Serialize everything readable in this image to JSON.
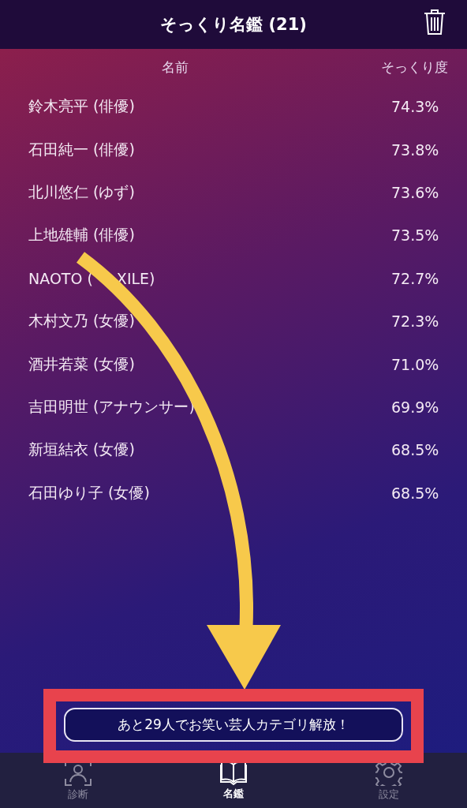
{
  "header": {
    "title": "そっくり名鑑 (21)"
  },
  "table": {
    "columns": [
      "名前",
      "そっくり度"
    ],
    "rows": [
      {
        "name": "鈴木亮平 (俳優)",
        "score": "74.3%"
      },
      {
        "name": "石田純一 (俳優)",
        "score": "73.8%"
      },
      {
        "name": "北川悠仁 (ゆず)",
        "score": "73.6%"
      },
      {
        "name": "上地雄輔 (俳優)",
        "score": "73.5%"
      },
      {
        "name": "NAOTO (",
        "name_tail": "XILE)",
        "score": "72.7%"
      },
      {
        "name": "木村文乃 (女優)",
        "score": "72.3%"
      },
      {
        "name": "酒井若菜 (女優)",
        "score": "71.0%"
      },
      {
        "name": "吉田明世 (アナウンサー)",
        "score": "69.9%"
      },
      {
        "name": "新垣結衣 (女優)",
        "score": "68.5%"
      },
      {
        "name": "石田ゆり子 (女優)",
        "score": "68.5%"
      }
    ]
  },
  "unlock_button": {
    "label": "あと29人でお笑い芸人カテゴリ解放！"
  },
  "tab_bar": [
    {
      "kind": "diagnose",
      "label": "診断",
      "selected": false
    },
    {
      "kind": "book",
      "label": "名鑑",
      "selected": true
    },
    {
      "kind": "settings",
      "label": "設定",
      "selected": false
    }
  ]
}
